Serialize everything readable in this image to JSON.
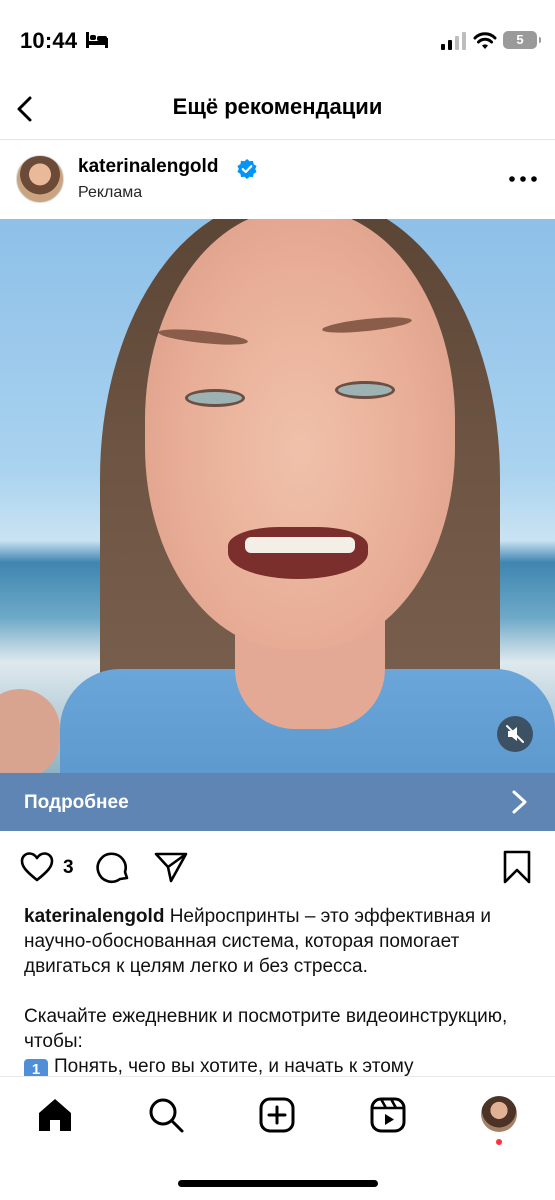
{
  "status_bar": {
    "time": "10:44",
    "battery_level": "5"
  },
  "header": {
    "title": "Ещё рекомендации"
  },
  "post": {
    "username": "katerinalengold",
    "verified": true,
    "sponsored_label": "Реклама",
    "cta_label": "Подробнее",
    "like_count": "3",
    "caption": {
      "username": "katerinalengold",
      "line1_text": " Нейроспринты – это эффективная и научно-обоснованная система, которая помогает двигаться к целям легко и без стресса.",
      "paragraph2": "Скачайте ежедневник и посмотрите видеоинструкцию, чтобы:",
      "item1_badge": "1",
      "item1_text": "Понять, чего вы хотите, и начать к этому"
    }
  },
  "colors": {
    "cta_background": "#5e85b3",
    "verified_badge": "#0095f6",
    "notification_dot": "#ff3040"
  },
  "icons": {
    "back": "chevron-left-icon",
    "more": "more-horizontal-icon",
    "mute": "speaker-muted-icon",
    "cta": "chevron-right-icon",
    "like": "heart-icon",
    "comment": "comment-icon",
    "share": "send-icon",
    "save": "bookmark-icon",
    "tabs": [
      "home-icon",
      "search-icon",
      "create-icon",
      "reels-icon",
      "profile-avatar"
    ]
  }
}
